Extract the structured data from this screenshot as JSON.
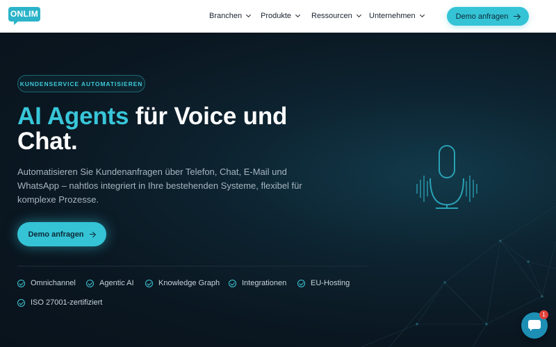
{
  "header": {
    "logo_text": "ONLIM",
    "nav": [
      {
        "label": "Branchen"
      },
      {
        "label": "Produkte"
      },
      {
        "label": "Ressourcen"
      },
      {
        "label": "Unternehmen"
      }
    ],
    "cta_label": "Demo anfragen"
  },
  "hero": {
    "badge": "KUNDENSERVICE AUTOMATISIEREN",
    "title_highlight": "AI Agents",
    "title_rest_line1": " für Voice und",
    "title_line2": "Chat.",
    "lead": "Automatisieren Sie Kundenanfragen über Telefon, Chat, E-Mail und WhatsApp – nahtlos integriert in Ihre bestehenden Systeme, flexibel für komplexe Prozesse.",
    "cta_label": "Demo anfragen",
    "features": [
      {
        "label": "Omnichannel"
      },
      {
        "label": "Agentic AI"
      },
      {
        "label": "Knowledge Graph"
      },
      {
        "label": "Integrationen"
      },
      {
        "label": "EU-Hosting"
      },
      {
        "label": "ISO 27001-zertifiziert"
      }
    ]
  },
  "chat_widget": {
    "badge_count": "1"
  },
  "colors": {
    "accent": "#35c3d6",
    "background": "#0b1822",
    "badge_red": "#e0413b"
  }
}
